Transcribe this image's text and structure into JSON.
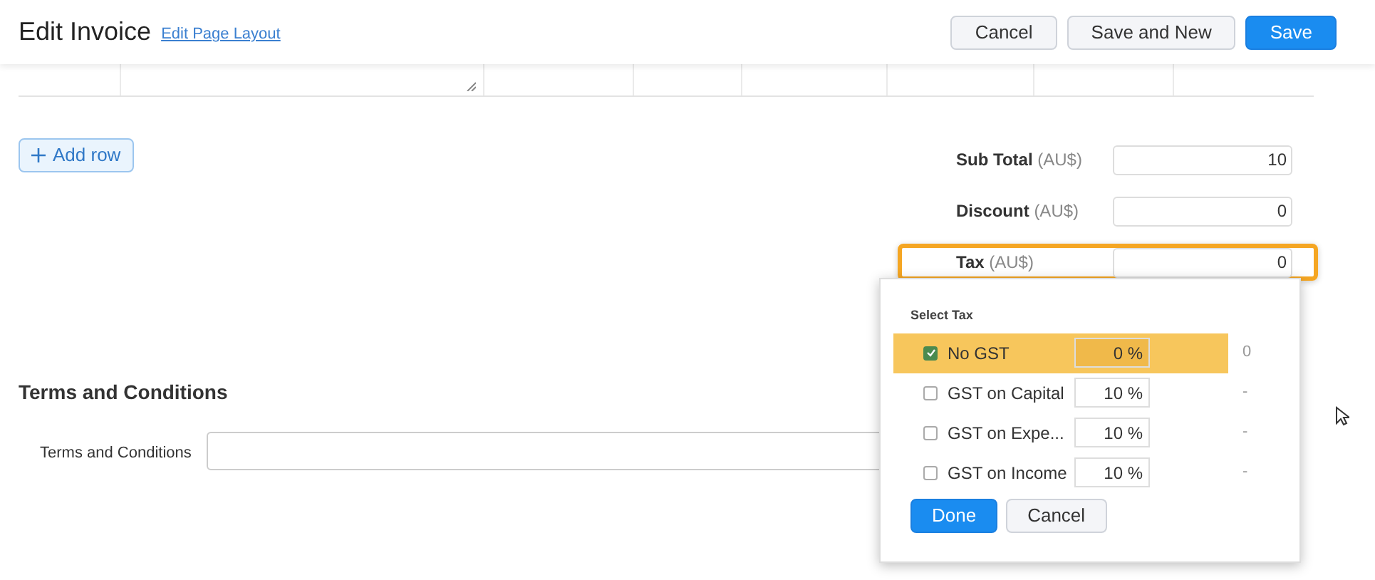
{
  "header": {
    "title": "Edit Invoice",
    "layout_link": "Edit Page Layout",
    "buttons": [
      {
        "label": "Cancel",
        "kind": "secondary"
      },
      {
        "label": "Save and New",
        "kind": "secondary"
      },
      {
        "label": "Save",
        "kind": "primary"
      }
    ]
  },
  "add_row": {
    "label": "Add row"
  },
  "totals": [
    {
      "label": "Sub Total",
      "unit": "(AU$)",
      "value": "10",
      "focused": false
    },
    {
      "label": "Discount",
      "unit": "(AU$)",
      "value": "0",
      "focused": false
    },
    {
      "label": "Tax",
      "unit": "(AU$)",
      "value": "0",
      "focused": true
    }
  ],
  "tax_popup": {
    "heading": "Select Tax",
    "options": [
      {
        "name": "No GST",
        "rate": "0 %",
        "amount": "0",
        "checked": true
      },
      {
        "name": "GST on Capital",
        "rate": "10 %",
        "amount": "-",
        "checked": false
      },
      {
        "name": "GST on Expe...",
        "rate": "10 %",
        "amount": "-",
        "checked": false
      },
      {
        "name": "GST on Income",
        "rate": "10 %",
        "amount": "-",
        "checked": false
      }
    ],
    "buttons": [
      {
        "label": "Done",
        "kind": "primary"
      },
      {
        "label": "Cancel",
        "kind": "secondary"
      }
    ]
  },
  "terms": {
    "heading": "Terms and Conditions",
    "label": "Terms and Conditions"
  }
}
